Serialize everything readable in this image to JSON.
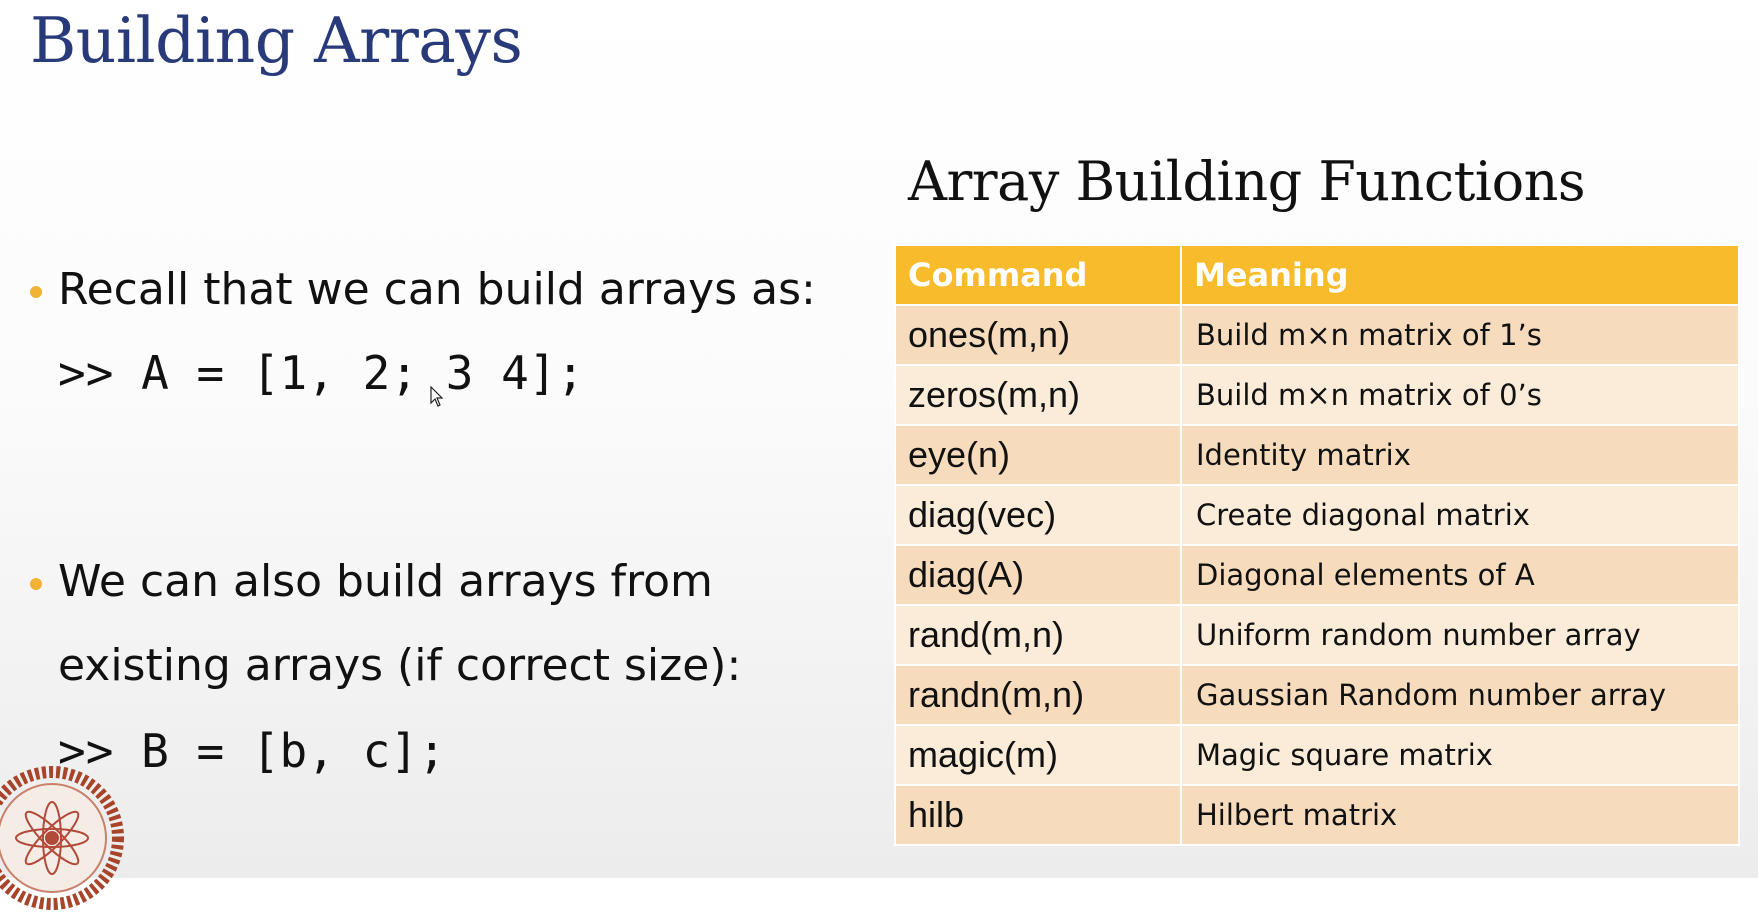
{
  "slide": {
    "title": "Building Arrays"
  },
  "bullets": [
    {
      "text": "Recall that we can build arrays as:",
      "code": ">> A = [1, 2; 3 4];"
    },
    {
      "line1": "We can also build arrays from",
      "line2": "existing arrays (if correct size):",
      "code": ">> B = [b, c];"
    }
  ],
  "table": {
    "title": "Array Building Functions",
    "headers": [
      "Command",
      "Meaning"
    ],
    "rows": [
      {
        "command": "ones(m,n)",
        "meaning": "Build m×n matrix of 1’s"
      },
      {
        "command": "zeros(m,n)",
        "meaning": "Build m×n matrix of 0’s"
      },
      {
        "command": "eye(n)",
        "meaning": "Identity matrix"
      },
      {
        "command": "diag(vec)",
        "meaning": "Create diagonal matrix"
      },
      {
        "command": "diag(A)",
        "meaning": "Diagonal elements of A"
      },
      {
        "command": "rand(m,n)",
        "meaning": "Uniform random number array"
      },
      {
        "command": "randn(m,n)",
        "meaning": "Gaussian Random number array"
      },
      {
        "command": "magic(m)",
        "meaning": "Magic square matrix"
      },
      {
        "command": "hilb",
        "meaning": "Hilbert matrix"
      }
    ]
  },
  "colors": {
    "title": "#283a7a",
    "bullet_dot": "#f2b233",
    "table_header": "#f7bb2b",
    "row_odd": "#f6dcbd",
    "row_even": "#faecd9"
  },
  "icons": {
    "logo": "institute-emblem-icon",
    "cursor": "mouse-pointer-icon"
  }
}
